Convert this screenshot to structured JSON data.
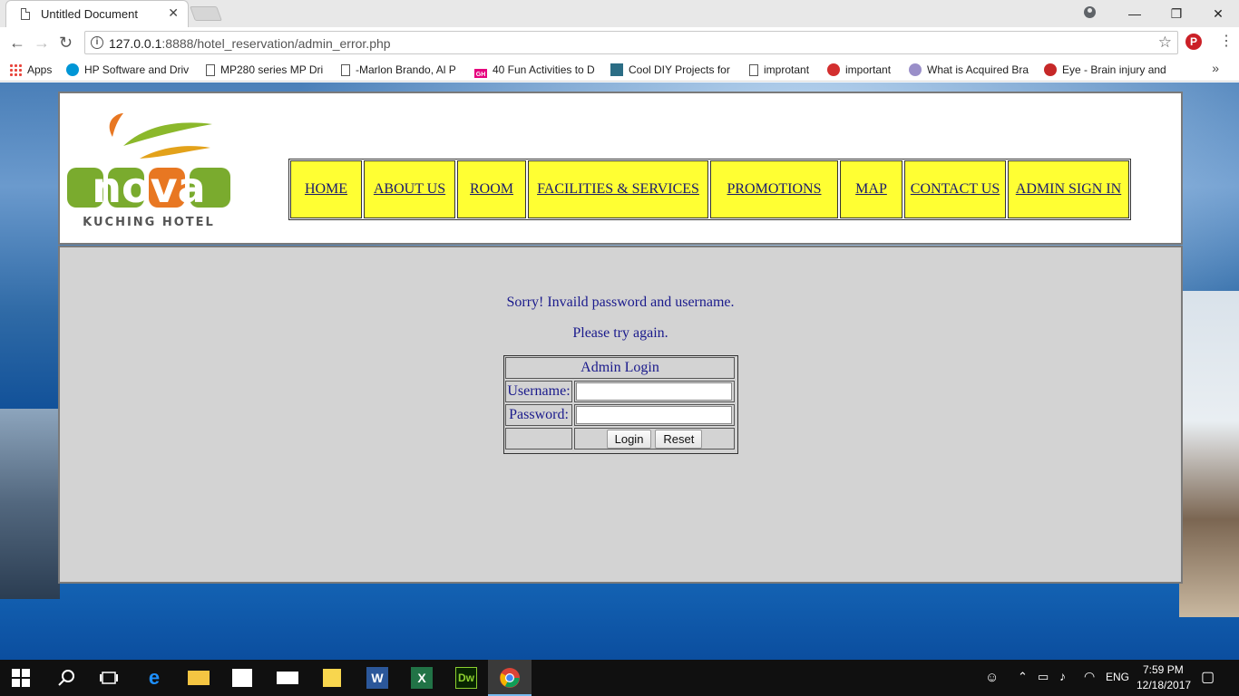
{
  "browser": {
    "tab_title": "Untitled Document",
    "tab_close": "✕",
    "url_host": "127.0.0.1",
    "url_path": ":8888/hotel_reservation/admin_error.php",
    "window_controls": {
      "minimize": "—",
      "maximize": "❐",
      "close": "✕"
    },
    "bookmarks": [
      {
        "label": "Apps",
        "icon": "apps-grid-icon"
      },
      {
        "label": "HP Software and Driv",
        "icon": "hp-icon"
      },
      {
        "label": "MP280 series MP Dri",
        "icon": "page-icon"
      },
      {
        "label": "-Marlon Brando, Al P",
        "icon": "page-icon"
      },
      {
        "label": "40 Fun Activities to D",
        "icon": "gh-icon"
      },
      {
        "label": "Cool DIY Projects for",
        "icon": "diy-icon"
      },
      {
        "label": "improtant",
        "icon": "page-icon"
      },
      {
        "label": "important",
        "icon": "apple-icon"
      },
      {
        "label": "What is Acquired Bra",
        "icon": "gear-icon"
      },
      {
        "label": "Eye - Brain injury and",
        "icon": "n-icon"
      }
    ],
    "bookmarks_overflow": "»"
  },
  "site": {
    "logo_word": "nova",
    "logo_tagline": "KUCHING HOTEL",
    "nav": [
      "HOME",
      "ABOUT US",
      "ROOM",
      "FACILITIES & SERVICES",
      "PROMOTIONS",
      "MAP",
      "CONTACT US",
      "ADMIN SIGN IN"
    ]
  },
  "error": {
    "line1": "Sorry! Invaild password and username.",
    "line2": "Please try again."
  },
  "login": {
    "title": "Admin Login",
    "username_label": "Username:",
    "password_label": "Password:",
    "username_value": "",
    "password_value": "",
    "login_button": "Login",
    "reset_button": "Reset"
  },
  "taskbar": {
    "time": "7:59 PM",
    "date": "12/18/2017",
    "language": "ENG"
  },
  "colors": {
    "nav_bg": "#ffff33",
    "content_bg": "#d3d3d3",
    "text_blue": "#1a1a8c"
  }
}
